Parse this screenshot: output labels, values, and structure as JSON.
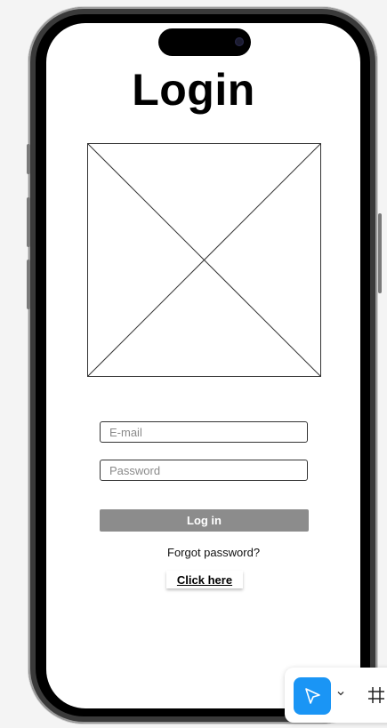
{
  "screen": {
    "title": "Login"
  },
  "form": {
    "email": {
      "value": "",
      "placeholder": "E-mail"
    },
    "password": {
      "value": "",
      "placeholder": "Password"
    },
    "login_label": "Log in",
    "forgot_text": "Forgot password?",
    "click_here_label": "Click here"
  },
  "toolbar": {
    "tools": [
      {
        "icon": "move-pointer-icon",
        "active": true
      },
      {
        "icon": "chevron-down-icon"
      },
      {
        "icon": "frame-hash-icon"
      }
    ],
    "accent": "#1a95f5"
  },
  "colors": {
    "button_bg": "#8c8c8c",
    "frame": "#000000"
  }
}
